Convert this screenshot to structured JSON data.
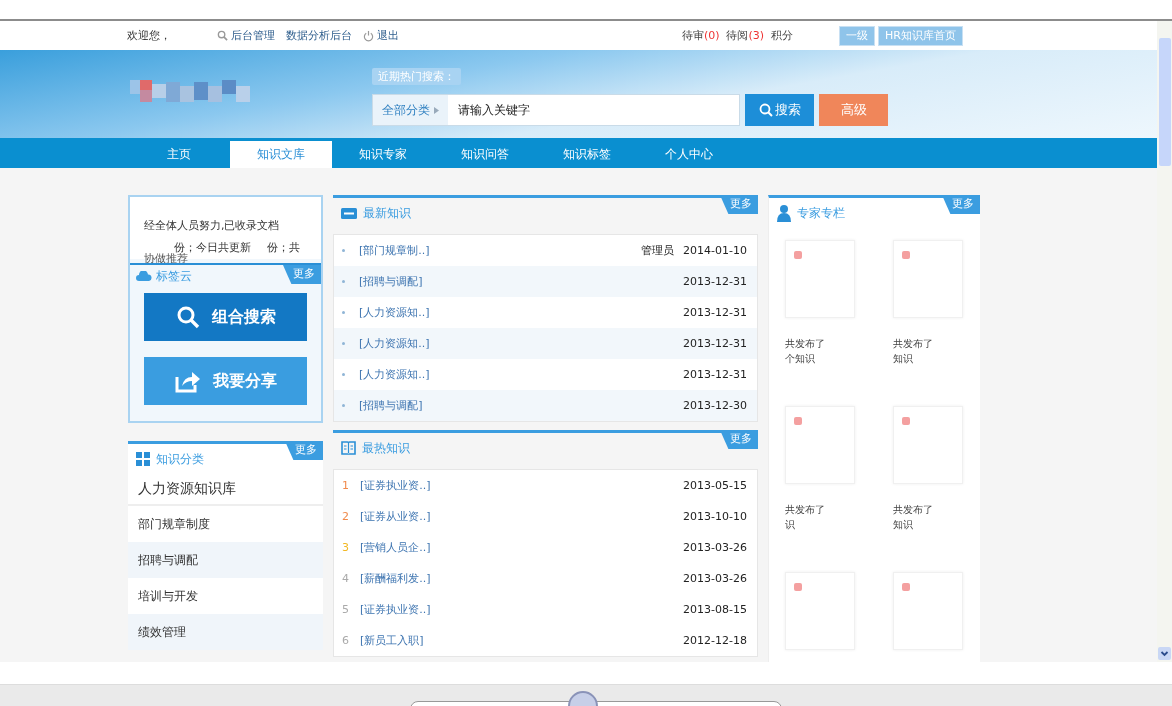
{
  "top_bar": {
    "welcome": "欢迎您，",
    "links": [
      {
        "label": "后台管理"
      },
      {
        "label": "数据分析后台"
      },
      {
        "label": "退出"
      }
    ],
    "counters": [
      {
        "label": "待审",
        "count": "(0)"
      },
      {
        "label": "待阅",
        "count": "(3)"
      },
      {
        "label": "积分"
      }
    ],
    "buttons": [
      "一级",
      "HR知识库首页"
    ]
  },
  "banner": {
    "hot_search_label": "近期热门搜索：",
    "category": "全部分类",
    "search_placeholder": "请输入关键字",
    "search_button": "搜索",
    "advanced_button": "高级"
  },
  "nav": [
    {
      "label": "主页",
      "selected": false
    },
    {
      "label": "知识文库",
      "selected": true
    },
    {
      "label": "知识专家",
      "selected": false
    },
    {
      "label": "知识问答",
      "selected": false
    },
    {
      "label": "知识标签",
      "selected": false
    },
    {
      "label": "个人中心",
      "selected": false
    }
  ],
  "left": {
    "notice": [
      "经全体人员努力,已收录文档",
      "份；今日共更新",
      "份；共"
    ],
    "recommend": "协做推荐",
    "tag_cloud": "标签云",
    "more": "更多",
    "actions": [
      {
        "label": "组合搜索"
      },
      {
        "label": "我要分享"
      }
    ],
    "categories_title": "知识分类",
    "categories_more": "更多",
    "categories": [
      {
        "label": "人力资源知识库",
        "children": [
          {
            "label": "部门规章制度"
          },
          {
            "label": "招聘与调配"
          },
          {
            "label": "培训与开发"
          },
          {
            "label": "绩效管理"
          }
        ]
      }
    ]
  },
  "latest": {
    "title": "最新知识",
    "more": "更多",
    "rows": [
      {
        "category": "[部门规章制..]",
        "author": "管理员",
        "date": "2014-01-10"
      },
      {
        "category": "[招聘与调配]",
        "date": "2013-12-31"
      },
      {
        "category": "[人力资源知..]",
        "date": "2013-12-31"
      },
      {
        "category": "[人力资源知..]",
        "date": "2013-12-31"
      },
      {
        "category": "[人力资源知..]",
        "date": "2013-12-31"
      },
      {
        "category": "[招聘与调配]",
        "date": "2013-12-30"
      }
    ]
  },
  "hottest": {
    "title": "最热知识",
    "more": "更多",
    "rows": [
      {
        "rank": "1",
        "color": "#f08a4b",
        "category": "[证券执业资..]",
        "date": "2013-05-15"
      },
      {
        "rank": "2",
        "color": "#f08a4b",
        "category": "[证券从业资..]",
        "date": "2013-10-10"
      },
      {
        "rank": "3",
        "color": "#f2b824",
        "category": "[营销人员企..]",
        "date": "2013-03-26"
      },
      {
        "rank": "4",
        "color": "#aaaaaa",
        "category": "[薪酬福利发..]",
        "date": "2013-03-26"
      },
      {
        "rank": "5",
        "color": "#aaaaaa",
        "category": "[证券执业资..]",
        "date": "2013-08-15"
      },
      {
        "rank": "6",
        "color": "#aaaaaa",
        "category": "[新员工入职]",
        "date": "2012-12-18"
      }
    ]
  },
  "experts": {
    "title": "专家专栏",
    "more": "更多",
    "cards": [
      {
        "kind": "captioned",
        "lines": [
          "共发布了",
          "个知识"
        ]
      },
      {
        "kind": "captioned",
        "lines": [
          "共发布了",
          "知识"
        ]
      },
      {
        "kind": "captioned",
        "lines": [
          "共发布了",
          "识"
        ]
      },
      {
        "kind": "captioned",
        "lines": [
          "共发布了",
          "知识"
        ]
      },
      {
        "kind": "photo"
      },
      {
        "kind": "photo"
      }
    ]
  }
}
